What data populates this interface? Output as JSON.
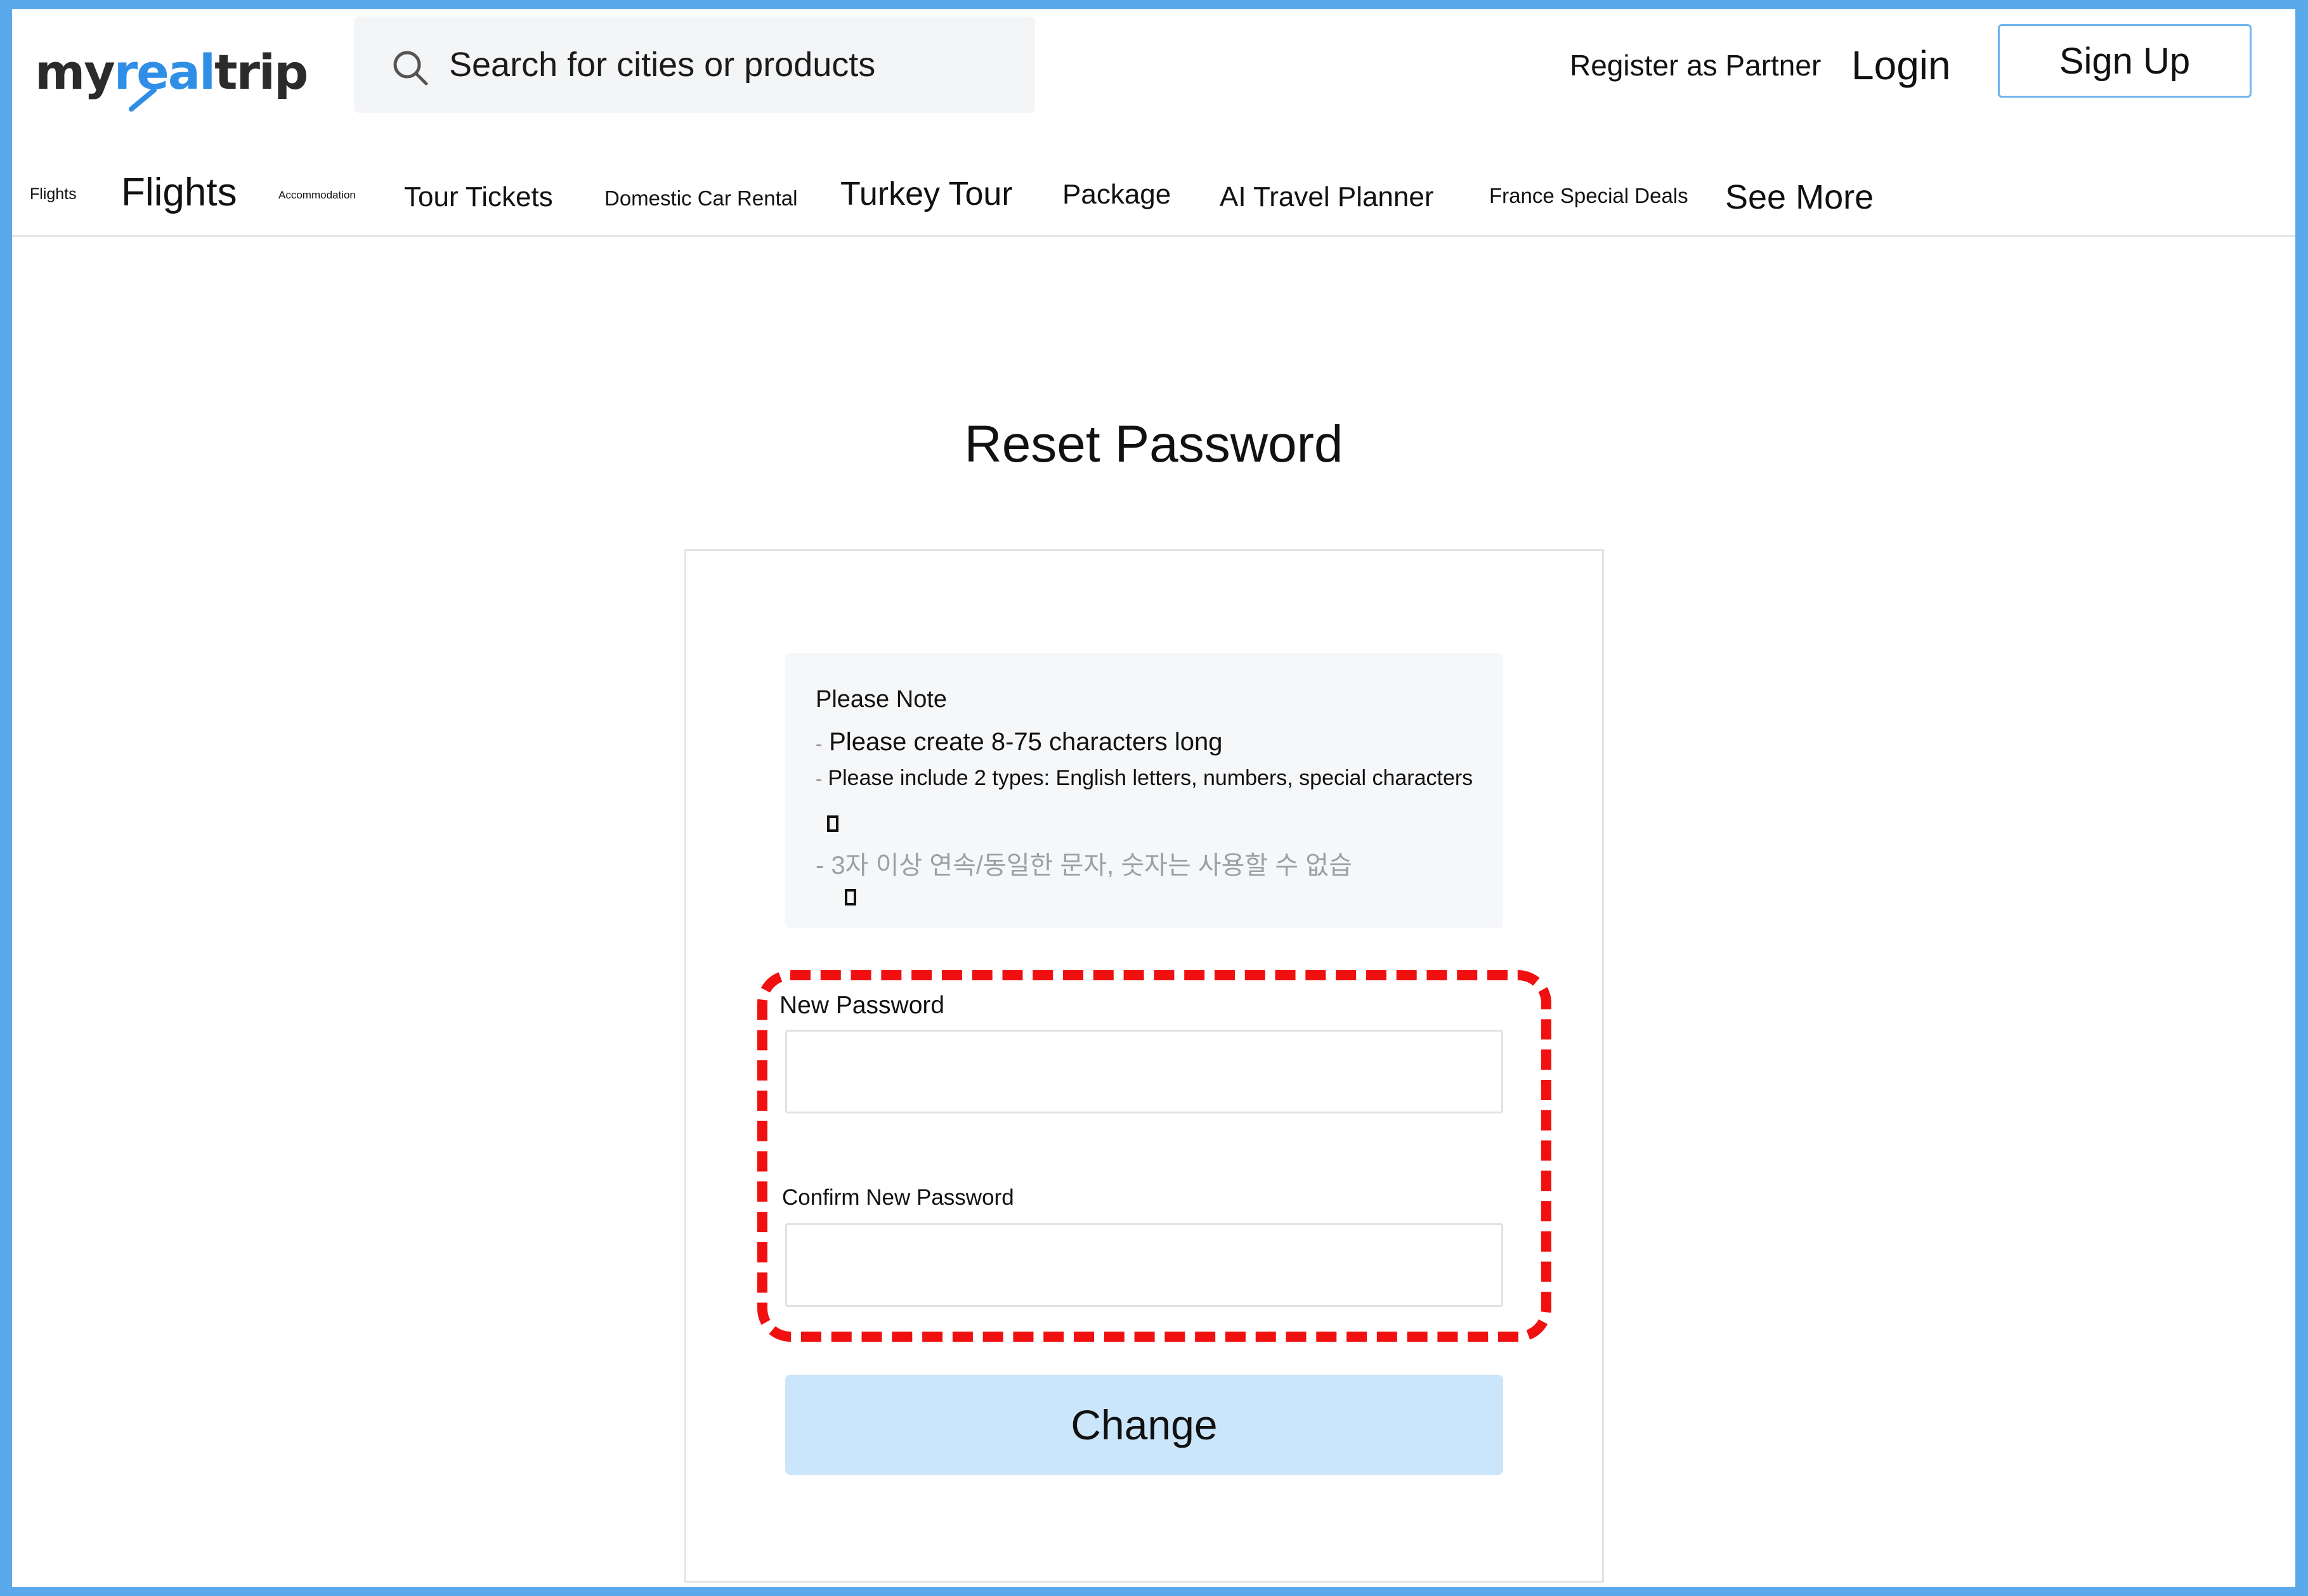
{
  "header": {
    "logo": {
      "part1": "my",
      "part2": "real",
      "part3": "trip"
    },
    "search_placeholder": "Search for cities or products",
    "register_label": "Register as Partner",
    "login_label": "Login",
    "signup_label": "Sign Up"
  },
  "nav": {
    "items": [
      {
        "label": "Flights"
      },
      {
        "label": "Flights"
      },
      {
        "label": "Accommodation"
      },
      {
        "label": "Tour Tickets"
      },
      {
        "label": "Domestic Car Rental"
      },
      {
        "label": "Turkey Tour"
      },
      {
        "label": "Package"
      },
      {
        "label": "AI Travel Planner"
      },
      {
        "label": "France Special Deals"
      },
      {
        "label": "See More"
      }
    ]
  },
  "main": {
    "title": "Reset Password",
    "note": {
      "title": "Please Note",
      "dash": "-",
      "lines": [
        "Please create 8-75 characters long",
        "Please include 2 types: English letters, numbers, special characters",
        "- 3자 이상 연속/동일한 문자, 숫자는 사용할 수 없습"
      ]
    },
    "new_password_label": "New Password",
    "confirm_password_label": "Confirm New Password",
    "new_password_value": "",
    "confirm_password_value": "",
    "change_label": "Change"
  },
  "colors": {
    "frame_border": "#5aa9ea",
    "brand_accent": "#2f8ee6",
    "button_bg": "#cbe6fb",
    "highlight": "#f01010"
  },
  "icons": [
    "search-icon",
    "logo-swoosh-icon",
    "missing-glyph-icon"
  ]
}
